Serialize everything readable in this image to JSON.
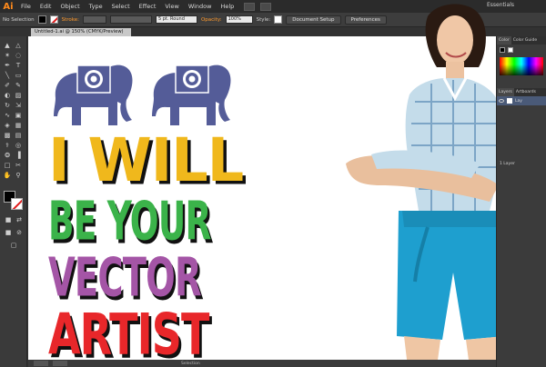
{
  "app": {
    "logo": "Ai"
  },
  "menu": [
    "File",
    "Edit",
    "Object",
    "Type",
    "Select",
    "Effect",
    "View",
    "Window",
    "Help"
  ],
  "workspace": "Essentials",
  "control_bar": {
    "selection_label": "No Selection",
    "stroke_label": "Stroke:",
    "brush_value": "5 pt. Round",
    "opacity_label": "Opacity:",
    "opacity_value": "100%",
    "style_label": "Style:",
    "document_setup": "Document Setup",
    "preferences": "Preferences"
  },
  "document_tab": "Untitled-1.ai @ 150% (CMYK/Preview)",
  "artwork": {
    "lines": [
      "I WILL",
      "BE YOUR",
      "VECTOR",
      "ARTIST"
    ],
    "colors": {
      "yellow": "#f0b81c",
      "green": "#3bb34a",
      "purple": "#a455a6",
      "red": "#e8272a",
      "elephant": "#545c98"
    }
  },
  "right_panel": {
    "tabs": [
      "Color",
      "Color Guide"
    ],
    "layers_tabs": [
      "Layers",
      "Artboards"
    ],
    "layer_name": "Lay",
    "layer_count": "1 Layer"
  },
  "status": {
    "tool": "Selection"
  },
  "icons": [
    "selection-icon",
    "direct-selection-icon",
    "pen-icon",
    "type-icon",
    "line-icon",
    "rectangle-icon",
    "brush-icon",
    "pencil-icon",
    "rotate-icon",
    "scale-icon",
    "warp-icon",
    "free-transform-icon",
    "symbol-sprayer-icon",
    "graph-icon",
    "mesh-icon",
    "gradient-icon",
    "eyedropper-icon",
    "blend-icon",
    "slice-icon",
    "eraser-icon",
    "hand-icon",
    "zoom-icon"
  ]
}
